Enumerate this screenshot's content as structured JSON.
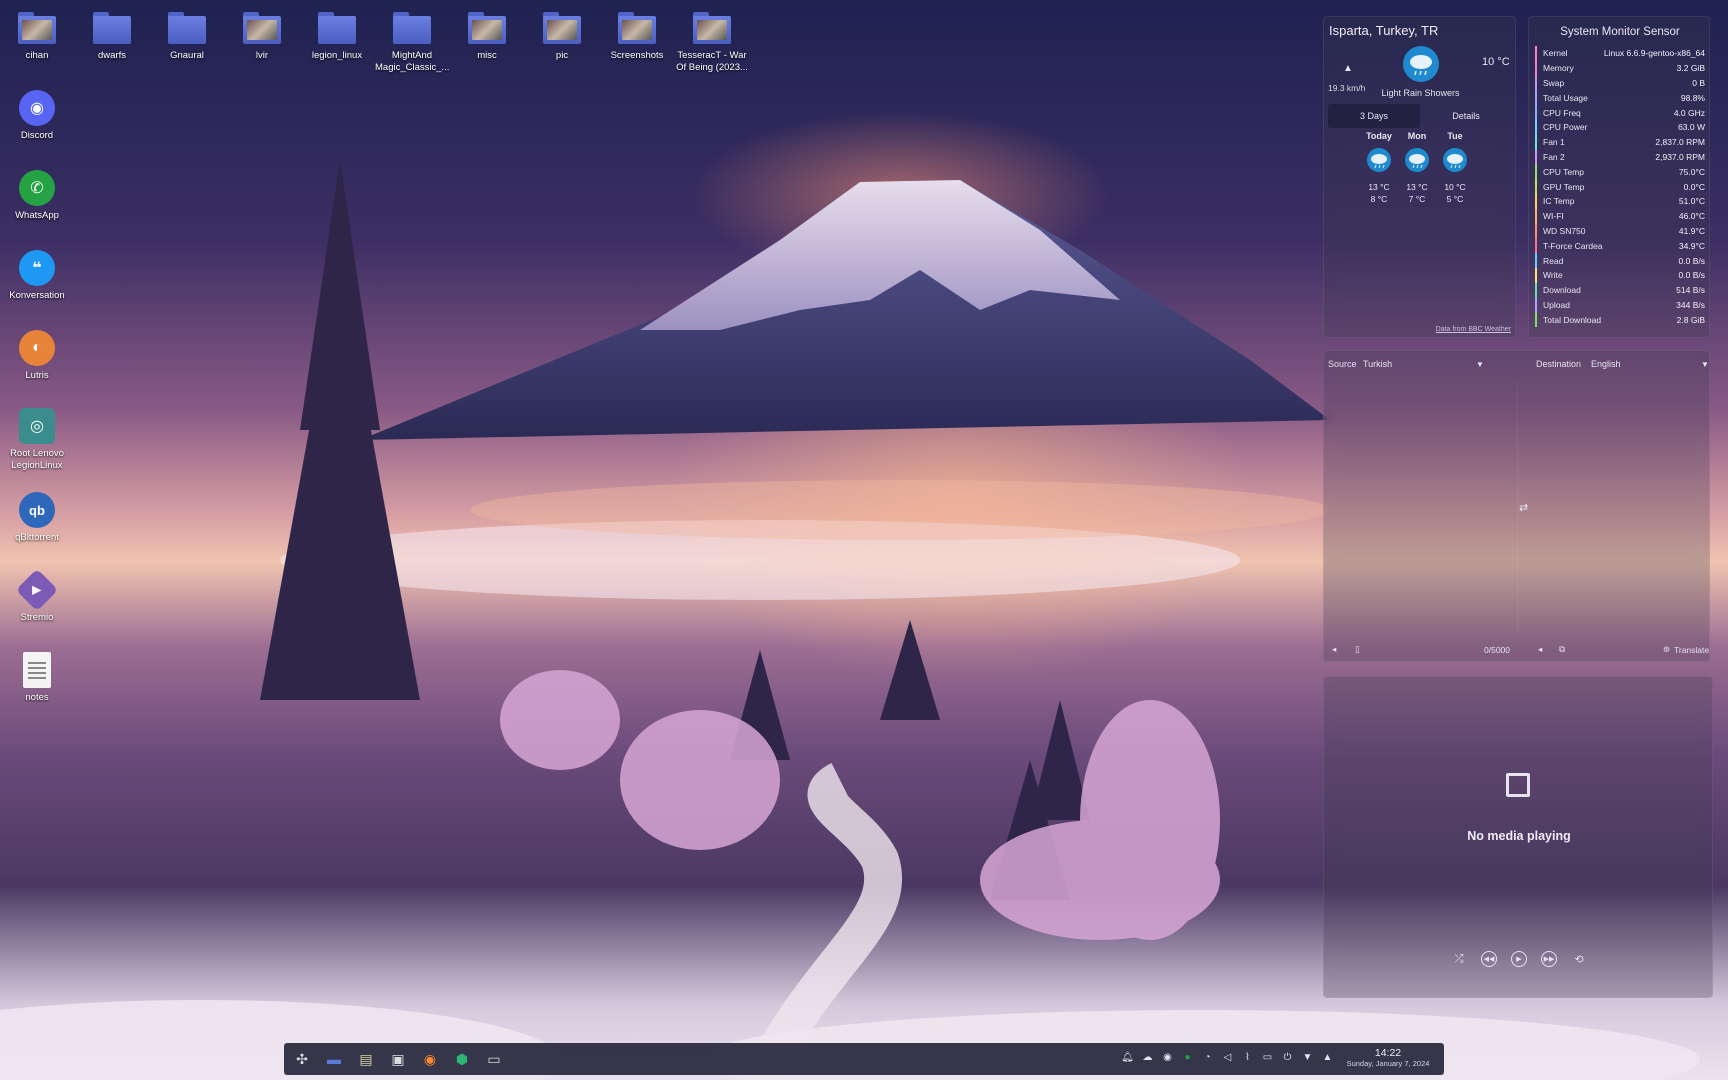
{
  "desktop": {
    "top_icons": [
      {
        "label": "cihan",
        "icon": "home-folder-icon"
      },
      {
        "label": "dwarfs",
        "icon": "folder-icon"
      },
      {
        "label": "Gnaural",
        "icon": "folder-icon"
      },
      {
        "label": "lvir",
        "icon": "image-folder-icon"
      },
      {
        "label": "legion_linux",
        "icon": "folder-icon"
      },
      {
        "label": "MightAnd Magic_Classic_...",
        "icon": "folder-icon"
      },
      {
        "label": "misc",
        "icon": "image-folder-icon"
      },
      {
        "label": "pic",
        "icon": "image-folder-icon"
      },
      {
        "label": "Screenshots",
        "icon": "image-folder-icon"
      },
      {
        "label": "TesseracT - War Of Being (2023...",
        "icon": "image-folder-icon"
      }
    ],
    "left_icons": [
      {
        "label": "Discord",
        "icon": "discord-icon",
        "color": "#5865f2"
      },
      {
        "label": "WhatsApp",
        "icon": "whatsapp-icon",
        "color": "#25a244"
      },
      {
        "label": "Konversation",
        "icon": "konversation-icon",
        "color": "#1d99f3"
      },
      {
        "label": "Lutris",
        "icon": "lutris-icon",
        "color": "#e8833a"
      },
      {
        "label": "Root Lenovo LegionLinux",
        "icon": "legion-icon",
        "color": "#3b8c8c"
      },
      {
        "label": "qBittorrent",
        "icon": "qbittorrent-icon",
        "color": "#2f67ba"
      },
      {
        "label": "Stremio",
        "icon": "stremio-icon",
        "color": "#7b5bb6"
      },
      {
        "label": "notes",
        "icon": "text-file-icon",
        "color": "#eeeeee"
      }
    ]
  },
  "weather": {
    "location": "Isparta, Turkey, TR",
    "wind_speed": "19.3 km/h",
    "temperature": "10 °C",
    "condition": "Light Rain Showers",
    "tabs": [
      "3 Days",
      "Details"
    ],
    "forecast": [
      {
        "day": "Today",
        "high": "13 °C",
        "low": "8 °C"
      },
      {
        "day": "Mon",
        "high": "13 °C",
        "low": "7 °C"
      },
      {
        "day": "Tue",
        "high": "10 °C",
        "low": "5 °C"
      }
    ],
    "credit": "Data from BBC Weather"
  },
  "sysmon": {
    "title": "System Monitor Sensor",
    "rows": [
      {
        "label": "Kernel",
        "value": "Linux 6.6.9-gentoo-x86_64",
        "color": "#ff7fbf"
      },
      {
        "label": "Memory",
        "value": "3.2 GiB",
        "color": "#f07fd0"
      },
      {
        "label": "Swap",
        "value": "0 B",
        "color": "#c890f0"
      },
      {
        "label": "Total Usage",
        "value": "98.8%",
        "color": "#a0a0ff"
      },
      {
        "label": "CPU Freq",
        "value": "4.0 GHz",
        "color": "#80b0ff"
      },
      {
        "label": "CPU Power",
        "value": "63.0 W",
        "color": "#70d0ff"
      },
      {
        "label": "Fan 1",
        "value": "2,837.0 RPM",
        "color": "#70e0e0"
      },
      {
        "label": "Fan 2",
        "value": "2,937.0 RPM",
        "color": "#d090ff"
      },
      {
        "label": "CPU Temp",
        "value": "75.0°C",
        "color": "#90e070"
      },
      {
        "label": "GPU Temp",
        "value": "0.0°C",
        "color": "#c0e060"
      },
      {
        "label": "IC Temp",
        "value": "51.0°C",
        "color": "#ffd060"
      },
      {
        "label": "WI-FI",
        "value": "46.0°C",
        "color": "#ffb060"
      },
      {
        "label": "WD SN750",
        "value": "41.9°C",
        "color": "#ff9070"
      },
      {
        "label": "T-Force Cardea",
        "value": "34.9°C",
        "color": "#ff7090"
      },
      {
        "label": "Read",
        "value": "0.0 B/s",
        "color": "#60d0ff"
      },
      {
        "label": "Write",
        "value": "0.0 B/s",
        "color": "#ffe070"
      },
      {
        "label": "Download",
        "value": "514 B/s",
        "color": "#60e0b0"
      },
      {
        "label": "Upload",
        "value": "344 B/s",
        "color": "#b0a0ff"
      },
      {
        "label": "Total Download",
        "value": "2.8 GiB",
        "color": "#80e060"
      }
    ]
  },
  "translator": {
    "source_label": "Source",
    "source_value": "Turkish",
    "destination_label": "Destination",
    "destination_value": "English",
    "char_count": "0/5000",
    "translate_label": "Translate"
  },
  "media": {
    "status": "No media playing"
  },
  "taskbar": {
    "time": "14:22",
    "date": "Sunday, January 7, 2024"
  }
}
